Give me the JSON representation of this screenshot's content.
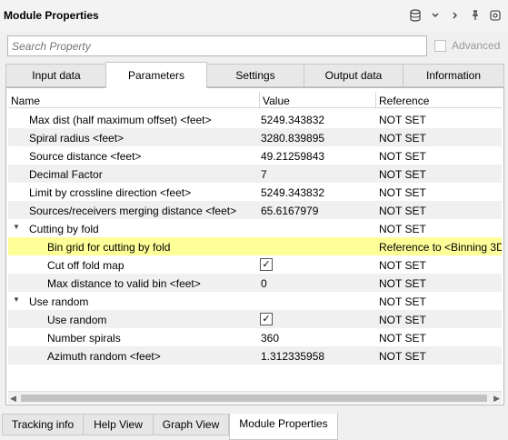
{
  "window": {
    "title": "Module Properties"
  },
  "toolbar": {
    "icons": [
      "database-icon",
      "chevron-down-icon",
      "chevron-right-icon",
      "pin-icon",
      "settings-icon"
    ]
  },
  "search": {
    "placeholder": "Search Property",
    "advanced_label": "Advanced"
  },
  "tabs": [
    {
      "label": "Input data"
    },
    {
      "label": "Parameters"
    },
    {
      "label": "Settings"
    },
    {
      "label": "Output data"
    },
    {
      "label": "Information"
    }
  ],
  "grid": {
    "columns": [
      "Name",
      "Value",
      "Reference"
    ],
    "rows": [
      {
        "name": "Max dist (half maximum offset) <feet>",
        "value": "5249.343832",
        "ref": "NOT SET"
      },
      {
        "name": "Spiral radius <feet>",
        "value": "3280.839895",
        "ref": "NOT SET"
      },
      {
        "name": "Source distance <feet>",
        "value": "49.21259843",
        "ref": "NOT SET"
      },
      {
        "name": "Decimal Factor",
        "value": "7",
        "ref": "NOT SET"
      },
      {
        "name": "Limit by crossline direction <feet>",
        "value": "5249.343832",
        "ref": "NOT SET"
      },
      {
        "name": "Sources/receivers  merging distance <feet>",
        "value": "65.6167979",
        "ref": "NOT SET"
      },
      {
        "name": "Cutting by fold",
        "value": "",
        "ref": "NOT SET"
      },
      {
        "name": "Bin grid for cutting by fold",
        "value": "",
        "ref": "Reference to <Binning 3D"
      },
      {
        "name": "Cut off fold map",
        "value": "checked",
        "ref": "NOT SET"
      },
      {
        "name": "Max distance to valid bin <feet>",
        "value": "0",
        "ref": "NOT SET"
      },
      {
        "name": "Use random",
        "value": "",
        "ref": "NOT SET"
      },
      {
        "name": "Use random",
        "value": "checked",
        "ref": "NOT SET"
      },
      {
        "name": "Number spirals",
        "value": "360",
        "ref": "NOT SET"
      },
      {
        "name": "Azimuth random <feet>",
        "value": "1.312335958",
        "ref": "NOT SET"
      }
    ]
  },
  "bottom_tabs": [
    {
      "label": "Tracking info"
    },
    {
      "label": "Help View"
    },
    {
      "label": "Graph View"
    },
    {
      "label": "Module Properties"
    }
  ]
}
